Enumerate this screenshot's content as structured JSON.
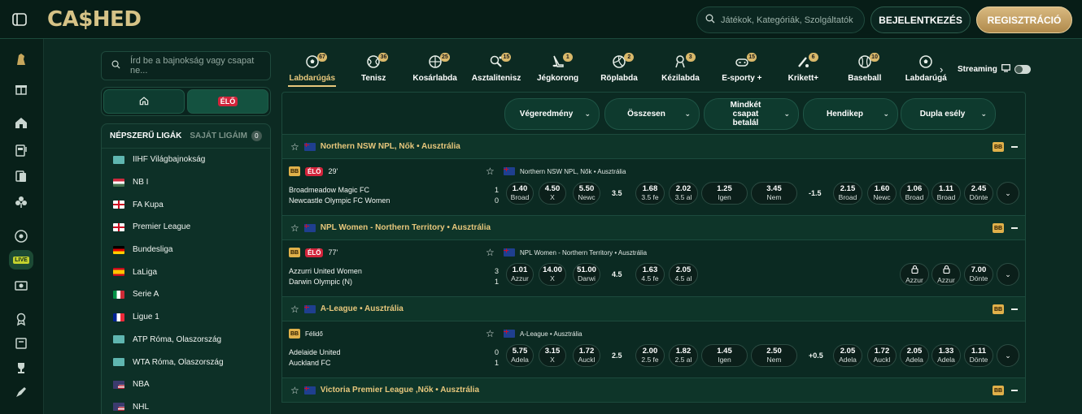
{
  "header": {
    "logo": "CA$HED",
    "search_placeholder": "Játékok, Kategóriák, Szolgáltatók",
    "login": "BEJELENTKEZÉS",
    "register": "REGISZTRÁCIÓ"
  },
  "sidebar": {
    "search_placeholder": "Írd be a bajnokság vagy csapat ne...",
    "live_label": "ÉLŐ",
    "tab_popular": "NÉPSZERŰ LIGÁK",
    "tab_mine": "SAJÁT LIGÁIM",
    "mine_count": "0",
    "leagues": [
      {
        "name": "IIHF Világbajnokság",
        "flag": "world"
      },
      {
        "name": "NB I",
        "flag": "hu"
      },
      {
        "name": "FA Kupa",
        "flag": "en"
      },
      {
        "name": "Premier League",
        "flag": "en"
      },
      {
        "name": "Bundesliga",
        "flag": "de"
      },
      {
        "name": "LaLiga",
        "flag": "es"
      },
      {
        "name": "Serie A",
        "flag": "it"
      },
      {
        "name": "Ligue 1",
        "flag": "fr"
      },
      {
        "name": "ATP Róma, Olaszország",
        "flag": "world"
      },
      {
        "name": "WTA Róma, Olaszország",
        "flag": "world"
      },
      {
        "name": "NBA",
        "flag": "us"
      },
      {
        "name": "NHL",
        "flag": "us"
      }
    ]
  },
  "sports": [
    {
      "label": "Labdarúgás",
      "count": "67",
      "icon": "soccer-ball-icon",
      "active": true
    },
    {
      "label": "Tenisz",
      "count": "36",
      "icon": "tennis-ball-icon"
    },
    {
      "label": "Kosárlabda",
      "count": "25",
      "icon": "basketball-icon"
    },
    {
      "label": "Asztalitenisz",
      "count": "15",
      "icon": "table-tennis-icon"
    },
    {
      "label": "Jégkorong",
      "count": "1",
      "icon": "hockey-icon"
    },
    {
      "label": "Röplabda",
      "count": "2",
      "icon": "volleyball-icon"
    },
    {
      "label": "Kézilabda",
      "count": "3",
      "icon": "handball-icon"
    },
    {
      "label": "E-sporty +",
      "count": "15",
      "icon": "esports-icon"
    },
    {
      "label": "Krikett+",
      "count": "6",
      "icon": "cricket-icon"
    },
    {
      "label": "Baseball",
      "count": "10",
      "icon": "baseball-icon"
    },
    {
      "label": "Labdarúgá",
      "count": "",
      "icon": "soccer-ai-icon"
    }
  ],
  "streaming_label": "Streaming",
  "markets": [
    "Végeredmény",
    "Összesen",
    "Mindkét csapat betalál",
    "Hendikep",
    "Dupla esély"
  ],
  "groups": [
    {
      "league": "Northern NSW NPL, Nők • Ausztrália",
      "match": {
        "status": "ÉLŐ",
        "clock": "29'",
        "league": "Northern NSW NPL, Nők • Ausztrália",
        "home": "Broadmeadow Magic FC",
        "away": "Newcastle Olympic FC Women",
        "score_home": "1",
        "score_away": "0",
        "result": [
          {
            "v": "1.40",
            "l": "Broad"
          },
          {
            "v": "4.50",
            "l": "X"
          },
          {
            "v": "5.50",
            "l": "Newc"
          }
        ],
        "total_line": "3.5",
        "total": [
          {
            "v": "1.68",
            "l": "3.5 fe"
          },
          {
            "v": "2.02",
            "l": "3.5 al"
          }
        ],
        "btts": [
          {
            "v": "1.25",
            "l": "Igen"
          },
          {
            "v": "3.45",
            "l": "Nem"
          }
        ],
        "hcp_line": "-1.5",
        "hcp": [
          {
            "v": "2.15",
            "l": "Broad"
          },
          {
            "v": "1.60",
            "l": "Newc"
          }
        ],
        "dc": [
          {
            "v": "1.06",
            "l": "Broad"
          },
          {
            "v": "1.11",
            "l": "Broad"
          },
          {
            "v": "2.45",
            "l": "Dönte"
          }
        ]
      }
    },
    {
      "league": "NPL Women - Northern Territory • Ausztrália",
      "match": {
        "status": "ÉLŐ",
        "clock": "77'",
        "league": "NPL Women - Northern Territory • Ausztrália",
        "home": "Azzurri United Women",
        "away": "Darwin Olympic (N)",
        "score_home": "3",
        "score_away": "1",
        "result": [
          {
            "v": "1.01",
            "l": "Azzur"
          },
          {
            "v": "14.00",
            "l": "X"
          },
          {
            "v": "51.00",
            "l": "Darwi"
          }
        ],
        "total_line": "4.5",
        "total": [
          {
            "v": "1.63",
            "l": "4.5 fe"
          },
          {
            "v": "2.05",
            "l": "4.5 al"
          }
        ],
        "dc": [
          {
            "v": "",
            "l": "Azzur"
          },
          {
            "v": "",
            "l": "Azzur"
          },
          {
            "v": "7.00",
            "l": "Dönte"
          }
        ]
      }
    },
    {
      "league": "A-League • Ausztrália",
      "match": {
        "status": "Félidő",
        "clock": "",
        "league": "A-League • Ausztrália",
        "home": "Adelaide United",
        "away": "Auckland FC",
        "score_home": "0",
        "score_away": "1",
        "result": [
          {
            "v": "5.75",
            "l": "Adela"
          },
          {
            "v": "3.15",
            "l": "X"
          },
          {
            "v": "1.72",
            "l": "Auckl"
          }
        ],
        "total_line": "2.5",
        "total": [
          {
            "v": "2.00",
            "l": "2.5 fe"
          },
          {
            "v": "1.82",
            "l": "2.5 al"
          }
        ],
        "btts": [
          {
            "v": "1.45",
            "l": "Igen"
          },
          {
            "v": "2.50",
            "l": "Nem"
          }
        ],
        "hcp_line": "+0.5",
        "hcp": [
          {
            "v": "2.05",
            "l": "Adela"
          },
          {
            "v": "1.72",
            "l": "Auckl"
          }
        ],
        "dc": [
          {
            "v": "2.05",
            "l": "Adela"
          },
          {
            "v": "1.33",
            "l": "Adela"
          },
          {
            "v": "1.11",
            "l": "Dönte"
          }
        ]
      }
    },
    {
      "league": "Victoria Premier League ,Nők • Ausztrália"
    }
  ],
  "bb_label": "BB"
}
